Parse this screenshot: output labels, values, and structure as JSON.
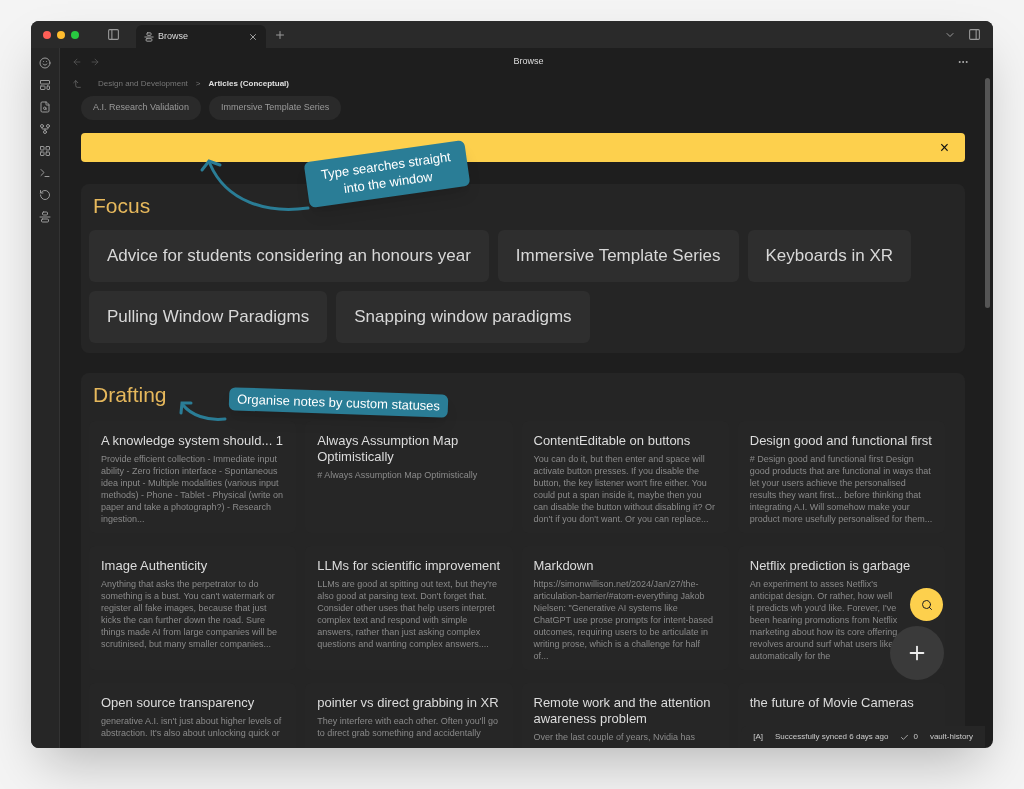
{
  "window": {
    "tab_title": "Browse",
    "title": "Browse"
  },
  "breadcrumb": {
    "parent": "Design and Development",
    "separator": ">",
    "current": "Articles (Conceptual)"
  },
  "chips": [
    "A.I. Research Validation",
    "Immersive Template Series"
  ],
  "search_banner": {
    "close": "×"
  },
  "focus": {
    "title": "Focus",
    "items": [
      "Advice for students considering an honours year",
      "Immersive Template Series",
      "Keyboards in XR",
      "Pulling Window Paradigms",
      "Snapping window paradigms"
    ]
  },
  "drafting": {
    "title": "Drafting",
    "cards": [
      {
        "title": "A knowledge system should... 1",
        "body": "Provide efficient collection - Immediate input ability - Zero friction interface - Spontaneous idea input - Multiple modalities (various input methods) - Phone - Tablet - Physical (write on paper and take a photograph?) - Research ingestion..."
      },
      {
        "title": "Always Assumption Map Optimistically",
        "body": "# Always Assumption Map Optimistically"
      },
      {
        "title": "ContentEditable on buttons",
        "body": "You can do it, but then enter and space will activate button presses. If you disable the button, the key listener won't fire either. You could put a span inside it, maybe then you can disable the button without disabling it? Or don't if you don't want. Or you can replace..."
      },
      {
        "title": "Design good and functional first",
        "body": "# Design good and functional first Design good products that are functional in ways that let your users achieve the personalised results they want first... before thinking that integrating A.I. Will somehow make your product more usefully personalised for them..."
      },
      {
        "title": "Image Authenticity",
        "body": "Anything that asks the perpetrator to do something is a bust. You can't watermark or register all fake images, because that just kicks the can further down the road. Sure things made AI from large companies will be scrutinised, but many smaller companies..."
      },
      {
        "title": "LLMs for scientific improvement",
        "body": "LLMs are good at spitting out text, but they're also good at parsing text. Don't forget that. Consider other uses that help users interpret complex text and respond with simple answers, rather than just asking complex questions and wanting complex answers...."
      },
      {
        "title": "Markdown",
        "body": "https://simonwillison.net/2024/Jan/27/the-articulation-barrier/#atom-everything Jakob Nielsen: \"Generative AI systems like ChatGPT use prose prompts for intent-based outcomes, requiring users to be articulate in writing prose, which is a challenge for half of..."
      },
      {
        "title": "Netflix prediction is garbage",
        "body": "An experiment to asses Netflix's anticipat design. Or rather, how well it predicts wh you'd like. Forever, I've been hearing promotions from Netflix marketing about how its core offering revolves around surf what users like automatically for the"
      },
      {
        "title": "Open source transparency",
        "body": "generative A.I. isn't just about higher levels of abstraction. It's also about unlocking quick or"
      },
      {
        "title": "pointer vs direct grabbing in XR",
        "body": "They interfere with each other. Often you'll go to direct grab something and accidentally"
      },
      {
        "title": "Remote work and the attention awareness problem",
        "body": "Over the last couple of years, Nvidia has"
      },
      {
        "title": "the future of Movie Cameras"
      }
    ]
  },
  "status_bar": {
    "marker": "[A]",
    "sync": "Successfully synced 6 days ago",
    "count": "0",
    "vault": "vault-history"
  },
  "annotations": [
    {
      "text": "Type searches straight into the window"
    },
    {
      "text": "Organise notes by custom statuses"
    }
  ]
}
